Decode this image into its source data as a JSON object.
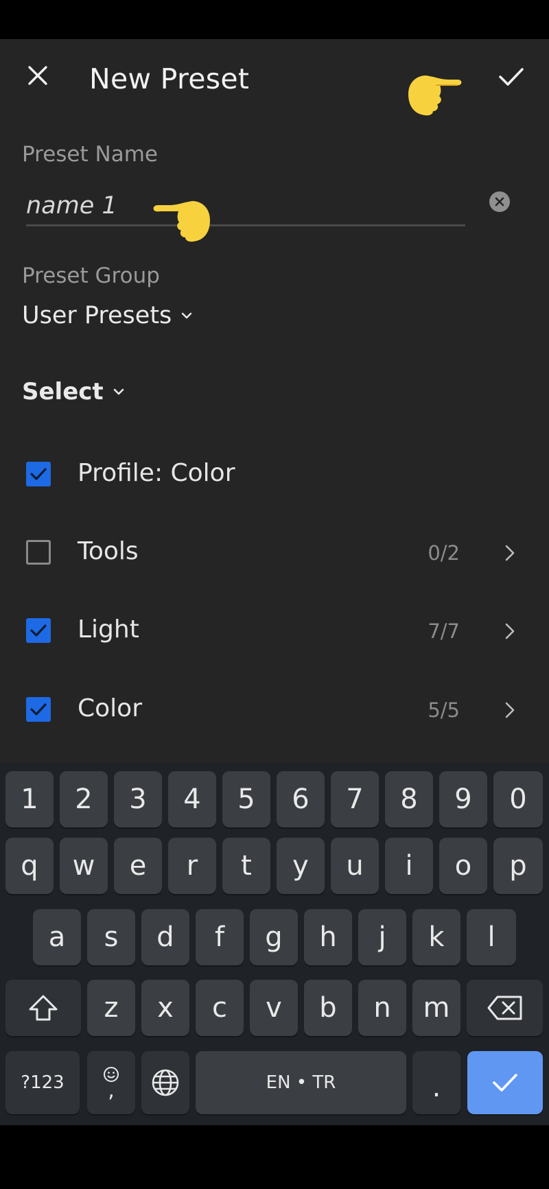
{
  "header": {
    "title": "New Preset"
  },
  "preset_name": {
    "label": "Preset Name",
    "value": "name 1"
  },
  "preset_group": {
    "label": "Preset Group",
    "value": "User Presets"
  },
  "select": {
    "label": "Select"
  },
  "settings": [
    {
      "label": "Profile: Color",
      "checked": true,
      "count": ""
    },
    {
      "label": "Tools",
      "checked": false,
      "count": "0/2"
    },
    {
      "label": "Light",
      "checked": true,
      "count": "7/7"
    },
    {
      "label": "Color",
      "checked": true,
      "count": "5/5"
    }
  ],
  "keyboard": {
    "row_numbers": [
      "1",
      "2",
      "3",
      "4",
      "5",
      "6",
      "7",
      "8",
      "9",
      "0"
    ],
    "row_top": [
      "q",
      "w",
      "e",
      "r",
      "t",
      "y",
      "u",
      "i",
      "o",
      "p"
    ],
    "row_middle": [
      "a",
      "s",
      "d",
      "f",
      "g",
      "h",
      "j",
      "k",
      "l"
    ],
    "row_bottom": [
      "z",
      "x",
      "c",
      "v",
      "b",
      "n",
      "m"
    ],
    "symbols_label": "?123",
    "emoji_comma_label": ",",
    "space_label": "EN • TR",
    "period_label": "."
  },
  "colors": {
    "background": "#252525",
    "accent_blue": "#1e6ae5",
    "hand_yellow": "#f7d23e",
    "enter_key": "#5f97f3"
  },
  "icons": {
    "close": "close-icon",
    "confirm": "checkmark-icon",
    "pointer": "pointing-hand-icon"
  }
}
